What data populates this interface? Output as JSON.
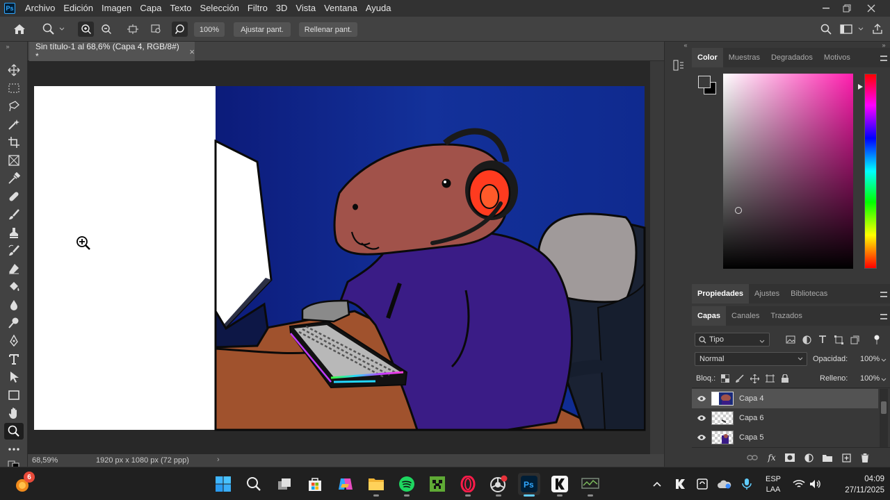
{
  "menubar": {
    "logo": "Ps",
    "items": [
      "Archivo",
      "Edición",
      "Imagen",
      "Capa",
      "Texto",
      "Selección",
      "Filtro",
      "3D",
      "Vista",
      "Ventana",
      "Ayuda"
    ]
  },
  "options": {
    "zoom_value": "100%",
    "fit_screen": "Ajustar pant.",
    "fill_screen": "Rellenar pant."
  },
  "document": {
    "tab_title": "Sin título-1 al 68,6% (Capa 4, RGB/8#) *"
  },
  "status": {
    "zoom": "68,59%",
    "dimensions": "1920 px x 1080 px (72 ppp)"
  },
  "color_panel": {
    "tabs": [
      "Color",
      "Muestras",
      "Degradados",
      "Motivos"
    ],
    "foreground": "#3a3a3a",
    "background": "#000000",
    "hue": "#ff1eae"
  },
  "props_panel": {
    "tabs": [
      "Propiedades",
      "Ajustes",
      "Bibliotecas"
    ]
  },
  "layers_panel": {
    "tabs": [
      "Capas",
      "Canales",
      "Trazados"
    ],
    "filter": "Tipo",
    "blend_mode": "Normal",
    "opacity_label": "Opacidad:",
    "opacity_value": "100%",
    "lock_label": "Bloq.:",
    "fill_label": "Relleno:",
    "fill_value": "100%",
    "layers": [
      {
        "name": "Capa 4",
        "selected": true
      },
      {
        "name": "Capa 6",
        "selected": false
      },
      {
        "name": "Capa 5",
        "selected": false
      }
    ]
  },
  "taskbar": {
    "copilot_badge": "6",
    "lang": "ESP",
    "layout": "LAA",
    "time": "04:09",
    "date": "27/11/2025"
  }
}
